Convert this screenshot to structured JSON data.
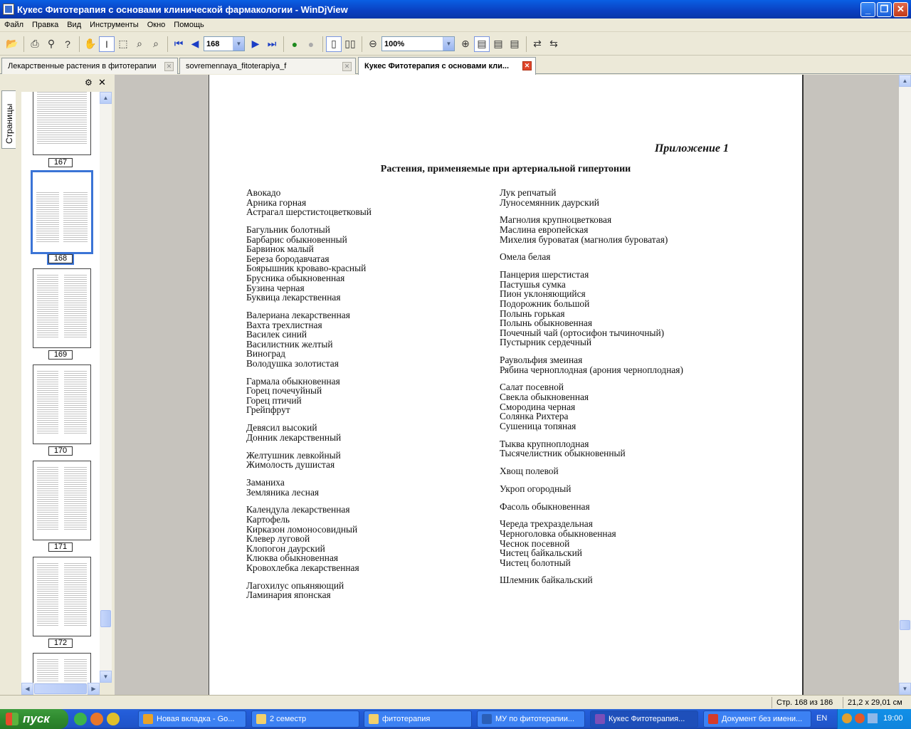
{
  "window": {
    "title": "Кукес Фитотерапия с основами клинической фармакологии - WinDjView",
    "buttons": {
      "minimize": "_",
      "maximize": "❐",
      "close": "✕"
    }
  },
  "menu": [
    "Файл",
    "Правка",
    "Вид",
    "Инструменты",
    "Окно",
    "Помощь"
  ],
  "toolbar": {
    "page_value": "168",
    "zoom_value": "100%"
  },
  "tabs": [
    {
      "label": "Лекарственные растения в фитотерапии",
      "active": false
    },
    {
      "label": "sovremennaya_fitoterapiya_f",
      "active": false
    },
    {
      "label": "Кукес Фитотерапия с основами кли...",
      "active": true
    }
  ],
  "sidebar": {
    "tab_label": "Страницы",
    "thumbnails": [
      "167",
      "168",
      "169",
      "170",
      "171",
      "172"
    ],
    "selected": "168"
  },
  "page": {
    "appendix": "Приложение 1",
    "title": "Растения, применяемые при артериальной гипертонии",
    "left_groups": [
      [
        "Авокадо",
        "Арника горная",
        "Астрагал шерстистоцветковый"
      ],
      [
        "Багульник болотный",
        "Барбарис обыкновенный",
        "Барвинок малый",
        "Береза бородавчатая",
        "Боярышник кроваво-красный",
        "Брусника обыкновенная",
        "Бузина черная",
        "Буквица лекарственная"
      ],
      [
        "Валериана лекарственная",
        "Вахта трехлистная",
        "Василек синий",
        "Василистник желтый",
        "Виноград",
        "Володушка золотистая"
      ],
      [
        "Гармала обыкновенная",
        "Горец почечуйный",
        "Горец птичий",
        "Грейпфрут"
      ],
      [
        "Девясил высокий",
        "Донник лекарственный"
      ],
      [
        "Желтушник левкойный",
        "Жимолость душистая"
      ],
      [
        "Заманиха",
        "Земляника лесная"
      ],
      [
        "Календула лекарственная",
        "Картофель",
        "Кирказон ломоносовидный",
        "Клевер луговой",
        "Клопогон даурский",
        "Клюква обыкновенная",
        "Кровохлебка лекарственная"
      ],
      [
        "Лагохилус опьяняющий",
        "Ламинария японская"
      ]
    ],
    "right_groups": [
      [
        "Лук репчатый",
        "Луносемянник даурский"
      ],
      [
        "Магнолия крупноцветковая",
        "Маслина европейская",
        "Михелия буроватая (магнолия буроватая)"
      ],
      [
        "Омела белая"
      ],
      [
        "Панцерия шерстистая",
        "Пастушья сумка",
        "Пион уклоняющийся",
        "Подорожник большой",
        "Полынь горькая",
        "Полынь обыкновенная",
        "Почечный чай (ортосифон тычиночный)",
        "Пустырник сердечный"
      ],
      [
        "Раувольфия змеиная",
        "Рябина черноплодная (арония черноплодная)"
      ],
      [
        "Салат посевной",
        "Свекла обыкновенная",
        "Смородина черная",
        "Солянка Рихтера",
        "Сушеница топяная"
      ],
      [
        "Тыква крупноплодная",
        "Тысячелистник обыкновенный"
      ],
      [
        "Хвощ полевой"
      ],
      [
        "Укроп огородный"
      ],
      [
        "Фасоль обыкновенная"
      ],
      [
        "Череда трехраздельная",
        "Черноголовка обыкновенная",
        "Чеснок посевной",
        "Чистец байкальский",
        "Чистец болотный"
      ],
      [
        "Шлемник байкальский"
      ]
    ]
  },
  "status": {
    "page_info": "Стр. 168 из 186",
    "page_size": "21,2 x 29,01 см"
  },
  "taskbar": {
    "start_label": "пуск",
    "tasks": [
      {
        "label": "Новая вкладка - Go...",
        "color": "#e8a32a"
      },
      {
        "label": "2 семестр",
        "color": "#f2d06b"
      },
      {
        "label": "фитотерапия",
        "color": "#f2d06b"
      },
      {
        "label": "МУ по фитотерапии...",
        "color": "#2b5fb8"
      },
      {
        "label": "Кукес Фитотерапия...",
        "color": "#7a4fb8"
      },
      {
        "label": "Документ без имени...",
        "color": "#d43b2a"
      }
    ],
    "language": "EN",
    "clock": "19:00"
  }
}
